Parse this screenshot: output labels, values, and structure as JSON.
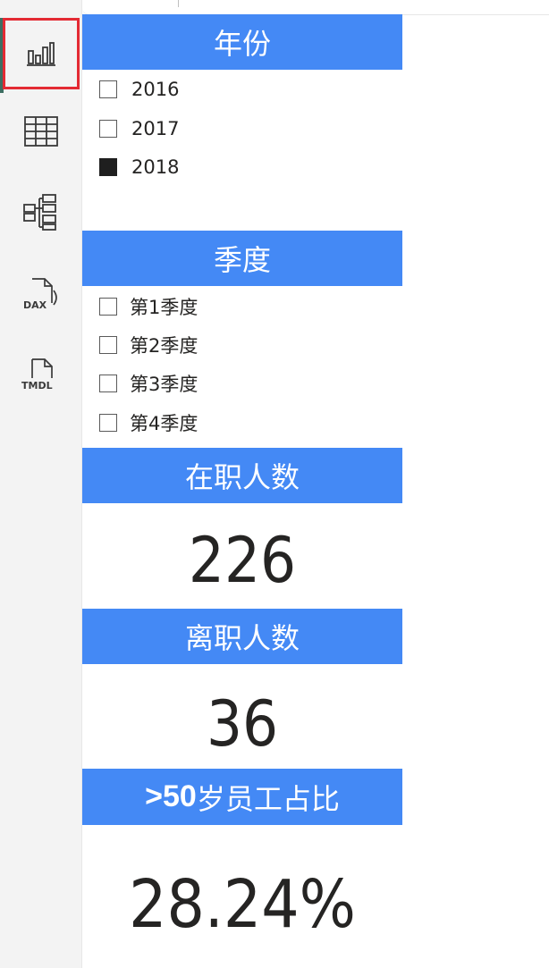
{
  "views": [
    {
      "icon": "report-view-icon",
      "active": true
    },
    {
      "icon": "table-view-icon",
      "active": false
    },
    {
      "icon": "model-view-icon",
      "active": false
    },
    {
      "icon": "dax-query-view-icon",
      "label": "DAX",
      "active": false
    },
    {
      "icon": "tmdl-view-icon",
      "label": "TMDL",
      "active": false
    }
  ],
  "year_slicer": {
    "title": "年份",
    "options": [
      {
        "label": "2016",
        "checked": false
      },
      {
        "label": "2017",
        "checked": false
      },
      {
        "label": "2018",
        "checked": true
      }
    ]
  },
  "quarter_slicer": {
    "title": "季度",
    "options": [
      {
        "label": "第1季度",
        "checked": false
      },
      {
        "label": "第2季度",
        "checked": false
      },
      {
        "label": "第3季度",
        "checked": false
      },
      {
        "label": "第4季度",
        "checked": false
      }
    ]
  },
  "kpis": {
    "active_employees": {
      "title": "在职人数",
      "value": "226"
    },
    "departed_employees": {
      "title": "离职人数",
      "value": "36"
    },
    "over50_ratio": {
      "title_prefix": ">50",
      "title_suffix": "岁员工占比",
      "value": "28.24%"
    }
  },
  "colors": {
    "header_blue": "#4489f5",
    "active_outline": "#e32a33",
    "rail_bg": "#f3f3f3"
  }
}
